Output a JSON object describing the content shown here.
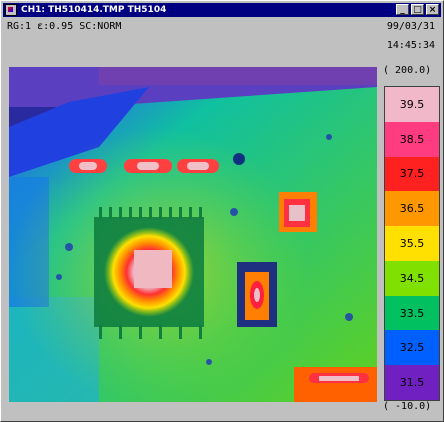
{
  "window": {
    "title": "CH1: TH510414.TMP  TH5104",
    "buttons": {
      "minimize": "_",
      "maximize": "□",
      "close": "×"
    }
  },
  "status": {
    "line": "RG:1  ε:0.95  SC:NORM",
    "date": "99/03/31",
    "time": "14:45:34"
  },
  "scale": {
    "max": "( 200.0)",
    "min": "( -10.0)",
    "levels": [
      {
        "label": "39.5",
        "color": "#f0b8c8"
      },
      {
        "label": "38.5",
        "color": "#ff3c80"
      },
      {
        "label": "37.5",
        "color": "#ff2020"
      },
      {
        "label": "36.5",
        "color": "#ff9800"
      },
      {
        "label": "35.5",
        "color": "#ffe000"
      },
      {
        "label": "34.5",
        "color": "#80e000"
      },
      {
        "label": "33.5",
        "color": "#00c060"
      },
      {
        "label": "32.5",
        "color": "#0060ff"
      },
      {
        "label": "31.5",
        "color": "#7020c0"
      }
    ]
  }
}
